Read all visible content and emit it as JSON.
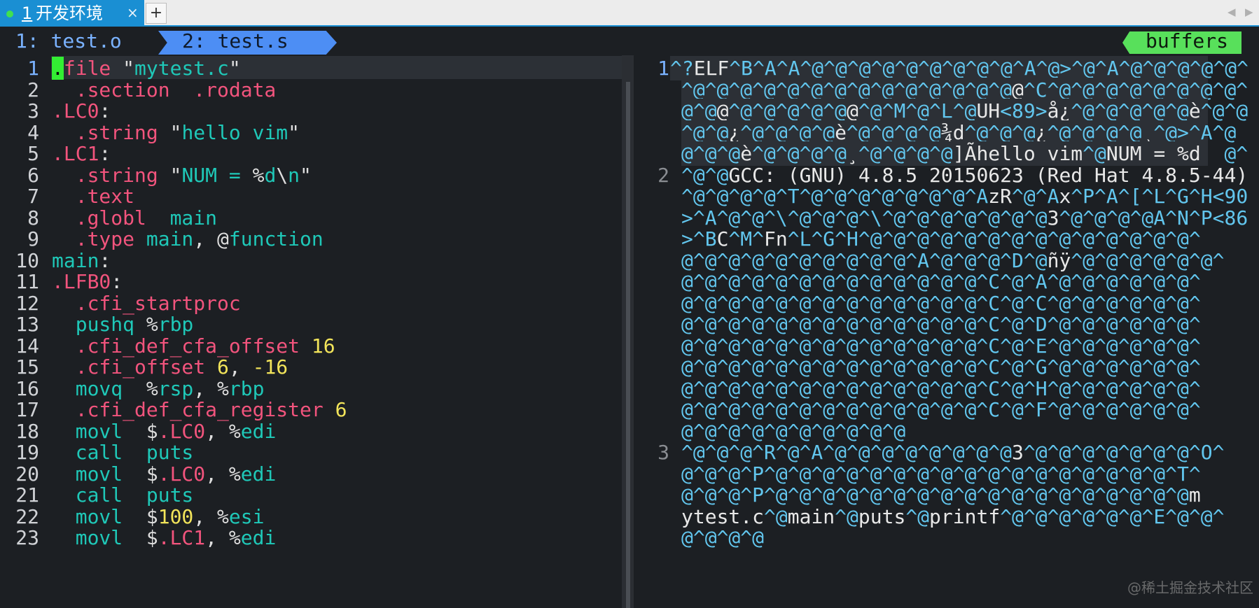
{
  "terminal_tabs": {
    "active_number": "1",
    "active_title": "开发环境",
    "close_glyph": "×",
    "new_tab_glyph": "+",
    "nav_left": "◀",
    "nav_right": "▶",
    "status_dot_color": "#40e050"
  },
  "vim_tabline": {
    "tabs": [
      {
        "label": "1: test.o",
        "active": false
      },
      {
        "label": "2: test.s",
        "active": true
      }
    ],
    "buffers_label": "buffers"
  },
  "left_buffer": {
    "file": "test.s",
    "current_line": 1,
    "lines": [
      {
        "n": "1",
        "segs": [
          {
            "c": "cursor",
            "t": "."
          },
          {
            "c": "r",
            "t": "file "
          },
          {
            "c": "w",
            "t": "\""
          },
          {
            "c": "t",
            "t": "mytest.c"
          },
          {
            "c": "w",
            "t": "\""
          }
        ]
      },
      {
        "n": "2",
        "segs": [
          {
            "c": "r",
            "t": "  .section  .rodata"
          }
        ]
      },
      {
        "n": "3",
        "segs": [
          {
            "c": "r",
            "t": ".LC0"
          },
          {
            "c": "w",
            "t": ":"
          }
        ]
      },
      {
        "n": "4",
        "segs": [
          {
            "c": "r",
            "t": "  .string "
          },
          {
            "c": "w",
            "t": "\""
          },
          {
            "c": "t",
            "t": "hello vim"
          },
          {
            "c": "w",
            "t": "\""
          }
        ]
      },
      {
        "n": "5",
        "segs": [
          {
            "c": "r",
            "t": ".LC1"
          },
          {
            "c": "w",
            "t": ":"
          }
        ]
      },
      {
        "n": "6",
        "segs": [
          {
            "c": "r",
            "t": "  .string "
          },
          {
            "c": "w",
            "t": "\""
          },
          {
            "c": "t",
            "t": "NUM = "
          },
          {
            "c": "w",
            "t": "%"
          },
          {
            "c": "t",
            "t": "d"
          },
          {
            "c": "w",
            "t": "\\"
          },
          {
            "c": "t",
            "t": "n"
          },
          {
            "c": "w",
            "t": "\""
          }
        ]
      },
      {
        "n": "7",
        "segs": [
          {
            "c": "r",
            "t": "  .text"
          }
        ]
      },
      {
        "n": "8",
        "segs": [
          {
            "c": "r",
            "t": "  .globl  "
          },
          {
            "c": "t",
            "t": "main"
          }
        ]
      },
      {
        "n": "9",
        "segs": [
          {
            "c": "r",
            "t": "  .type "
          },
          {
            "c": "t",
            "t": "main"
          },
          {
            "c": "w",
            "t": ", @"
          },
          {
            "c": "t",
            "t": "function"
          }
        ]
      },
      {
        "n": "10",
        "segs": [
          {
            "c": "t",
            "t": "main"
          },
          {
            "c": "w",
            "t": ":"
          }
        ]
      },
      {
        "n": "11",
        "segs": [
          {
            "c": "r",
            "t": ".LFB0"
          },
          {
            "c": "w",
            "t": ":"
          }
        ]
      },
      {
        "n": "12",
        "segs": [
          {
            "c": "r",
            "t": "  .cfi_startproc"
          }
        ]
      },
      {
        "n": "13",
        "segs": [
          {
            "c": "t",
            "t": "  pushq "
          },
          {
            "c": "w",
            "t": "%"
          },
          {
            "c": "t",
            "t": "rbp"
          }
        ]
      },
      {
        "n": "14",
        "segs": [
          {
            "c": "r",
            "t": "  .cfi_def_cfa_offset "
          },
          {
            "c": "y",
            "t": "16"
          }
        ]
      },
      {
        "n": "15",
        "segs": [
          {
            "c": "r",
            "t": "  .cfi_offset "
          },
          {
            "c": "y",
            "t": "6"
          },
          {
            "c": "w",
            "t": ", "
          },
          {
            "c": "y",
            "t": "-16"
          }
        ]
      },
      {
        "n": "16",
        "segs": [
          {
            "c": "t",
            "t": "  movq  "
          },
          {
            "c": "w",
            "t": "%"
          },
          {
            "c": "t",
            "t": "rsp"
          },
          {
            "c": "w",
            "t": ", %"
          },
          {
            "c": "t",
            "t": "rbp"
          }
        ]
      },
      {
        "n": "17",
        "segs": [
          {
            "c": "r",
            "t": "  .cfi_def_cfa_register "
          },
          {
            "c": "y",
            "t": "6"
          }
        ]
      },
      {
        "n": "18",
        "segs": [
          {
            "c": "t",
            "t": "  movl  "
          },
          {
            "c": "w",
            "t": "$"
          },
          {
            "c": "r",
            "t": ".LC0"
          },
          {
            "c": "w",
            "t": ", %"
          },
          {
            "c": "t",
            "t": "edi"
          }
        ]
      },
      {
        "n": "19",
        "segs": [
          {
            "c": "t",
            "t": "  call  puts"
          }
        ]
      },
      {
        "n": "20",
        "segs": [
          {
            "c": "t",
            "t": "  movl  "
          },
          {
            "c": "w",
            "t": "$"
          },
          {
            "c": "r",
            "t": ".LC0"
          },
          {
            "c": "w",
            "t": ", %"
          },
          {
            "c": "t",
            "t": "edi"
          }
        ]
      },
      {
        "n": "21",
        "segs": [
          {
            "c": "t",
            "t": "  call  puts"
          }
        ]
      },
      {
        "n": "22",
        "segs": [
          {
            "c": "t",
            "t": "  movl  "
          },
          {
            "c": "w",
            "t": "$"
          },
          {
            "c": "y",
            "t": "100"
          },
          {
            "c": "w",
            "t": ", %"
          },
          {
            "c": "t",
            "t": "esi"
          }
        ]
      },
      {
        "n": "23",
        "segs": [
          {
            "c": "t",
            "t": "  movl  "
          },
          {
            "c": "w",
            "t": "$"
          },
          {
            "c": "r",
            "t": ".LC1"
          },
          {
            "c": "w",
            "t": ", %"
          },
          {
            "c": "t",
            "t": "edi"
          }
        ]
      }
    ]
  },
  "right_buffer": {
    "file": "test.o",
    "current_line": 1,
    "rows": [
      {
        "n": "1",
        "hl": true,
        "segs": [
          {
            "c": "",
            "t": "^?"
          },
          {
            "c": "w",
            "t": "ELF"
          },
          {
            "c": "",
            "t": "^B^A^A^@^@^@^@^@^@^@^@^@^A^@>^@^A^@^@^@^@^@^"
          }
        ]
      },
      {
        "n": "",
        "hl": true,
        "segs": [
          {
            "c": "",
            "t": "^@^@^@^@^@^@^@^@^@^@^@^@^@^@"
          },
          {
            "c": "w",
            "t": "@"
          },
          {
            "c": "",
            "t": "^C^@^@^@^@^@^@^@^@^"
          }
        ]
      },
      {
        "n": "",
        "hl": true,
        "segs": [
          {
            "c": "",
            "t": "@^@"
          },
          {
            "c": "w",
            "t": "@"
          },
          {
            "c": "",
            "t": "^@^@^@^@^@"
          },
          {
            "c": "w",
            "t": "@"
          },
          {
            "c": "",
            "t": "^@^M^@^L^@"
          },
          {
            "c": "w",
            "t": "UH"
          },
          {
            "c": "",
            "t": "<89>"
          },
          {
            "c": "w",
            "t": "å¿"
          },
          {
            "c": "",
            "t": "^@^@^@^@^@"
          },
          {
            "c": "w",
            "t": "è"
          },
          {
            "c": "",
            "t": "^@^@"
          }
        ]
      },
      {
        "n": "",
        "hl": true,
        "segs": [
          {
            "c": "",
            "t": "^@^@"
          },
          {
            "c": "w",
            "t": "¿"
          },
          {
            "c": "",
            "t": "^@^@^@^@"
          },
          {
            "c": "w",
            "t": "è"
          },
          {
            "c": "",
            "t": "^@^@^@^@"
          },
          {
            "c": "w",
            "t": "¾d"
          },
          {
            "c": "",
            "t": "^@^@^@"
          },
          {
            "c": "w",
            "t": "¿"
          },
          {
            "c": "",
            "t": "^@^@^@^@"
          },
          {
            "c": "w",
            "t": "¸"
          },
          {
            "c": "",
            "t": "^@>^A^@"
          }
        ]
      },
      {
        "n": "",
        "hl": true,
        "segs": [
          {
            "c": "",
            "t": "@^@^@"
          },
          {
            "c": "w",
            "t": "è"
          },
          {
            "c": "",
            "t": "^@^@^@^@"
          },
          {
            "c": "w",
            "t": "¸"
          },
          {
            "c": "",
            "t": "^@^@^@^@"
          },
          {
            "c": "w",
            "t": "]Ãhello vim"
          },
          {
            "c": "",
            "t": "^@"
          },
          {
            "c": "w",
            "t": "NUM = %d  "
          },
          {
            "c": "",
            "t": "@^"
          }
        ]
      },
      {
        "n": "2",
        "hl": false,
        "segs": [
          {
            "c": "",
            "t": "^@^@"
          },
          {
            "c": "w",
            "t": "GCC: (GNU) 4.8.5 20150623 (Red Hat 4.8.5-44)"
          }
        ]
      },
      {
        "n": "",
        "hl": false,
        "segs": [
          {
            "c": "",
            "t": "^@^@^@^@^T^@^@^@^@^@^@^@^A"
          },
          {
            "c": "w",
            "t": "zR"
          },
          {
            "c": "",
            "t": "^@^A"
          },
          {
            "c": "w",
            "t": "x"
          },
          {
            "c": "",
            "t": "^P^A^[^L^G^H<90"
          }
        ]
      },
      {
        "n": "",
        "hl": false,
        "segs": [
          {
            "c": "",
            "t": ">^A^@^@^\\^@^@^@^\\^@^@^@^@^@^@^@"
          },
          {
            "c": "w",
            "t": "3"
          },
          {
            "c": "",
            "t": "^@^@^@^@A^N^P<86"
          }
        ]
      },
      {
        "n": "",
        "hl": false,
        "segs": [
          {
            "c": "",
            "t": ">^B"
          },
          {
            "c": "w",
            "t": "C"
          },
          {
            "c": "",
            "t": "^M^"
          },
          {
            "c": "w",
            "t": "Fn"
          },
          {
            "c": "",
            "t": "^L^G^H^@^@^@^@^@^@^@^@^@^@^@^@^@^@^"
          }
        ]
      },
      {
        "n": "",
        "hl": false,
        "segs": [
          {
            "c": "",
            "t": "@^@^@^@^@^@^@^@^@^@^A^@^@^@^D^@"
          },
          {
            "c": "w",
            "t": "ñÿ"
          },
          {
            "c": "",
            "t": "^@^@^@^@^@^@^"
          }
        ]
      },
      {
        "n": "",
        "hl": false,
        "segs": [
          {
            "c": "",
            "t": "@^@^@^@^@^@^@^@^@^@^@^@^@^C^@^A^@^@^@^@^@^@^"
          }
        ]
      },
      {
        "n": "",
        "hl": false,
        "segs": [
          {
            "c": "",
            "t": "@^@^@^@^@^@^@^@^@^@^@^@^@^C^@^C^@^@^@^@^@^@^"
          }
        ]
      },
      {
        "n": "",
        "hl": false,
        "segs": [
          {
            "c": "",
            "t": "@^@^@^@^@^@^@^@^@^@^@^@^@^C^@^D^@^@^@^@^@^@^"
          }
        ]
      },
      {
        "n": "",
        "hl": false,
        "segs": [
          {
            "c": "",
            "t": "@^@^@^@^@^@^@^@^@^@^@^@^@^C^@^E^@^@^@^@^@^@^"
          }
        ]
      },
      {
        "n": "",
        "hl": false,
        "segs": [
          {
            "c": "",
            "t": "@^@^@^@^@^@^@^@^@^@^@^@^@^C^@^G^@^@^@^@^@^@^"
          }
        ]
      },
      {
        "n": "",
        "hl": false,
        "segs": [
          {
            "c": "",
            "t": "@^@^@^@^@^@^@^@^@^@^@^@^@^C^@^H^@^@^@^@^@^@^"
          }
        ]
      },
      {
        "n": "",
        "hl": false,
        "segs": [
          {
            "c": "",
            "t": "@^@^@^@^@^@^@^@^@^@^@^@^@^C^@^F^@^@^@^@^@^@^"
          }
        ]
      },
      {
        "n": "",
        "hl": false,
        "segs": [
          {
            "c": "",
            "t": "@^@^@^@^@^@^@^@^@^@"
          }
        ]
      },
      {
        "n": "3",
        "hl": false,
        "segs": [
          {
            "c": "",
            "t": "^@^@^@^R^@^A^@^@^@^@^@^@^@^@"
          },
          {
            "c": "w",
            "t": "3"
          },
          {
            "c": "",
            "t": "^@^@^@^@^@^@^@^O^"
          }
        ]
      },
      {
        "n": "",
        "hl": false,
        "segs": [
          {
            "c": "",
            "t": "@^@^@^P^@^@^@^@^@^@^@^@^@^@^@^@^@^@^@^@^@^T^"
          }
        ]
      },
      {
        "n": "",
        "hl": false,
        "segs": [
          {
            "c": "",
            "t": "@^@^@^P^@^@^@^@^@^@^@^@^@^@^@^@^@^@^@^@^@^@"
          },
          {
            "c": "w",
            "t": "m"
          }
        ]
      },
      {
        "n": "",
        "hl": false,
        "segs": [
          {
            "c": "w",
            "t": "ytest.c"
          },
          {
            "c": "",
            "t": "^@"
          },
          {
            "c": "w",
            "t": "main"
          },
          {
            "c": "",
            "t": "^@"
          },
          {
            "c": "w",
            "t": "puts"
          },
          {
            "c": "",
            "t": "^@"
          },
          {
            "c": "w",
            "t": "printf"
          },
          {
            "c": "",
            "t": "^@^@^@^@^@^@^E^@^@^"
          }
        ]
      },
      {
        "n": "",
        "hl": false,
        "segs": [
          {
            "c": "",
            "t": "@^@^@^@"
          }
        ]
      }
    ]
  },
  "watermark": "@稀土掘金技术社区"
}
